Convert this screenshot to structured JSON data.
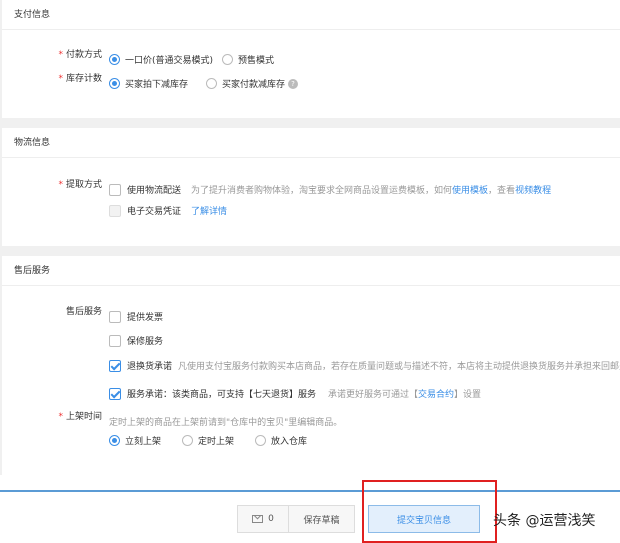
{
  "payment": {
    "title": "支付信息",
    "method_label": "付款方式",
    "method_options": [
      "一口价(普通交易模式)",
      "预售模式"
    ],
    "stock_label": "库存计数",
    "stock_options": [
      "买家拍下减库存",
      "买家付款减库存"
    ],
    "help": "?"
  },
  "logistics": {
    "title": "物流信息",
    "pickup_label": "提取方式",
    "use_logistics": "使用物流配送",
    "hint_prefix": "为了提升消费者购物体验，淘宝要求全网商品设置运费模板，如何",
    "hint_link1": "使用模板",
    "hint_mid": "，查看",
    "hint_link2": "视频教程",
    "e_voucher": "电子交易凭证",
    "learn_more": "了解详情"
  },
  "after_sale": {
    "title": "售后服务",
    "service_label": "售后服务",
    "invoice": "提供发票",
    "warranty": "保修服务",
    "return_promise": "退换货承诺",
    "return_hint": "凡使用支付宝服务付款购买本店商品，若存在质量问题或与描述不符，本店将主动提供退换货服务并承担来回邮费",
    "service_promise": "服务承诺：该类商品，可支持【七天退货】服务",
    "promise_hint_prefix": "承诺更好服务可通过【",
    "promise_link": "交易合约",
    "promise_hint_suffix": "】设置",
    "listing_label": "上架时间",
    "listing_hint": "定时上架的商品在上架前请到\"仓库中的宝贝\"里编辑商品。",
    "listing_options": [
      "立刻上架",
      "定时上架",
      "放入仓库"
    ]
  },
  "footer": {
    "message_count": "0",
    "save_draft": "保存草稿",
    "submit": "提交宝贝信息",
    "watermark": "头条 @运营浅笑"
  },
  "colors": {
    "accent": "#3a8ee6",
    "highlight": "#e02020"
  }
}
